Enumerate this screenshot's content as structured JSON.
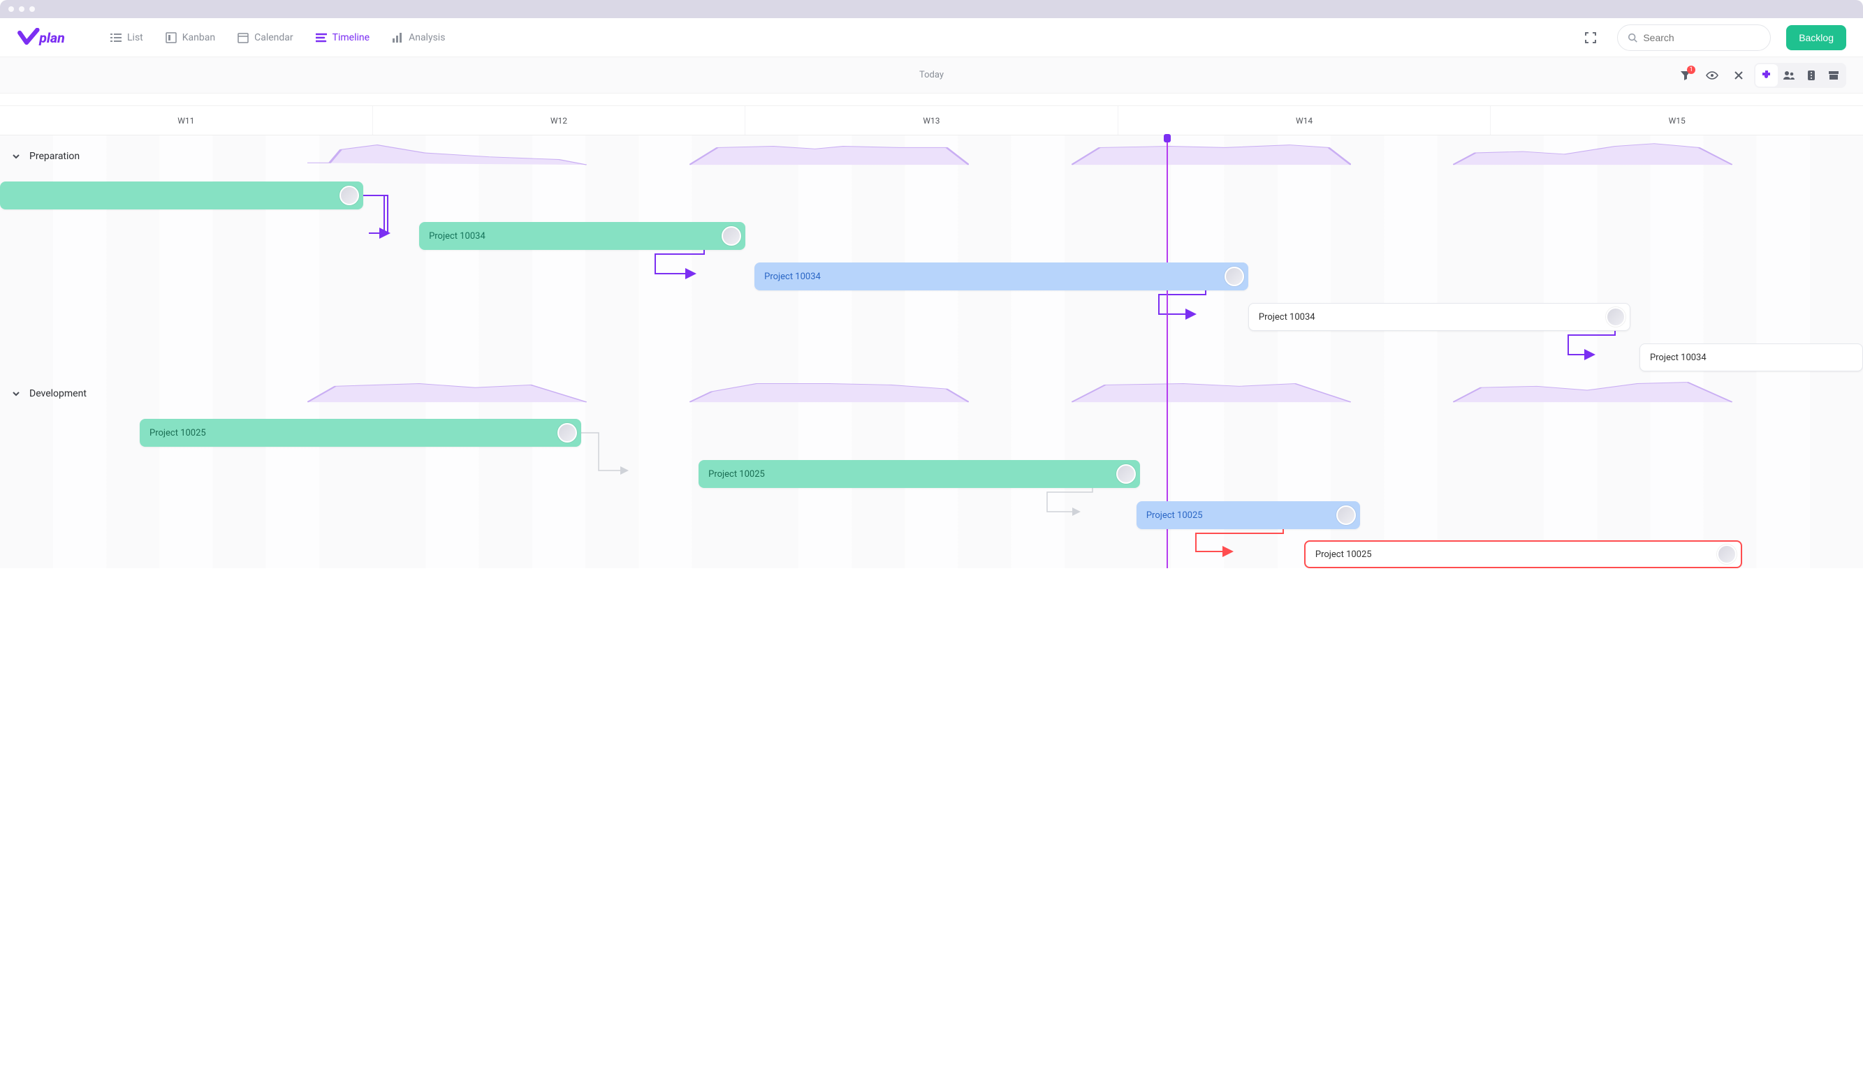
{
  "nav": {
    "list": "List",
    "kanban": "Kanban",
    "calendar": "Calendar",
    "timeline": "Timeline",
    "analysis": "Analysis"
  },
  "search": {
    "placeholder": "Search"
  },
  "buttons": {
    "backlog": "Backlog"
  },
  "toolbar": {
    "today": "Today",
    "filter_badge": "1"
  },
  "weeks": [
    "W11",
    "W12",
    "W13",
    "W14",
    "W15"
  ],
  "groups": {
    "preparation": {
      "label": "Preparation"
    },
    "development": {
      "label": "Development"
    }
  },
  "tasks": {
    "prep": [
      {
        "label": ""
      },
      {
        "label": "Project 10034"
      },
      {
        "label": "Project 10034"
      },
      {
        "label": "Project 10034"
      },
      {
        "label": "Project 10034"
      }
    ],
    "dev": [
      {
        "label": "Project 10025"
      },
      {
        "label": "Project 10025"
      },
      {
        "label": "Project 10025"
      },
      {
        "label": "Project 10025"
      }
    ]
  },
  "colors": {
    "brand": "#7b2ff2",
    "green": "#86e1c3",
    "blue": "#b7d4fb",
    "red": "#ff4d4f",
    "success": "#1fc18f"
  },
  "now_marker_pct": 62.6
}
